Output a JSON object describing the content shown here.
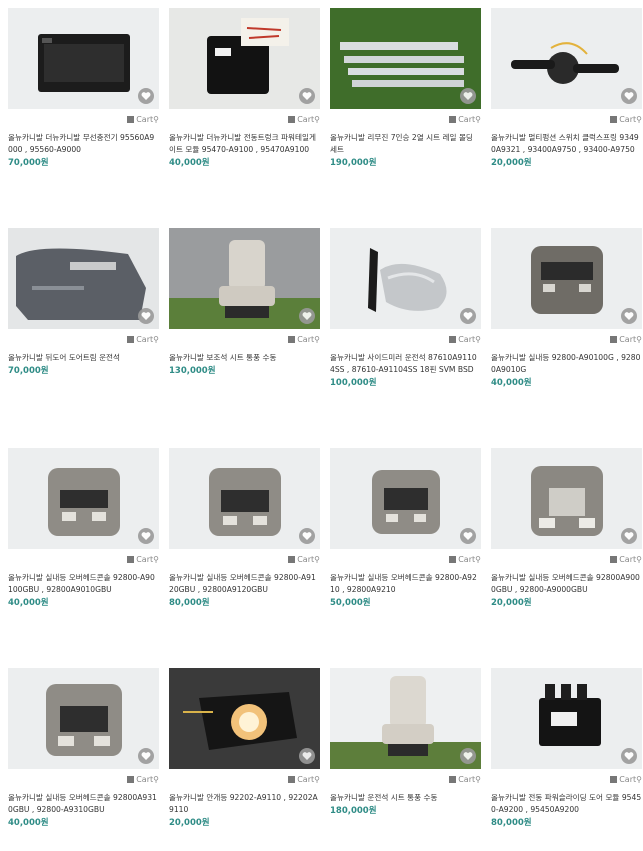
{
  "cart_label": "Cart",
  "heart_icon": "heart-icon",
  "products": [
    {
      "title": "올뉴카니발 더뉴카니발 무선충전기 95560A9000 , 95560-A9000",
      "price": "70,000원",
      "image": "wireless-charger-unit"
    },
    {
      "title": "올뉴카니발 더뉴카니발 전동트렁크 파워테일게이트 모듈 95470-A9100 , 95470A9100",
      "price": "40,000원",
      "image": "black-control-module"
    },
    {
      "title": "올뉴카니발 리무진 7인승 2열 시트 레일 몰딩 세트",
      "price": "190,000원",
      "image": "seat-rail-moldings"
    },
    {
      "title": "올뉴카니발 멀티펑션 스위치 클럭스프링 93490A9321 , 93400A9750 , 93400-A9750",
      "price": "20,000원",
      "image": "multifunction-switch"
    },
    {
      "title": "올뉴카니발 뒤도어 도어트림 운전석",
      "price": "70,000원",
      "image": "door-trim"
    },
    {
      "title": "올뉴카니발 보조석 시트 통풍 수동",
      "price": "130,000원",
      "image": "passenger-seat"
    },
    {
      "title": "올뉴카니발 사이드미러 운전석 87610A91104SS , 87610-A91104SS 18핀 SVM BSD",
      "price": "100,000원",
      "image": "side-mirror"
    },
    {
      "title": "올뉴카니발 실내등 92800-A90100G , 92800A9010G",
      "price": "40,000원",
      "image": "dome-light-a"
    },
    {
      "title": "올뉴카니발 실내등 오버헤드콘솔 92800-A90100GBU , 92800A9010GBU",
      "price": "40,000원",
      "image": "dome-light-b"
    },
    {
      "title": "올뉴카니발 실내등 오버헤드콘솔 92800-A9120GBU , 92800A9120GBU",
      "price": "80,000원",
      "image": "dome-light-c"
    },
    {
      "title": "올뉴카니발 실내등 오버헤드콘솔 92800-A9210 , 92800A9210",
      "price": "50,000원",
      "image": "dome-light-d"
    },
    {
      "title": "올뉴카니발 실내등 오버헤드콘솔 92800A9000GBU , 92800-A9000GBU",
      "price": "20,000원",
      "image": "dome-light-e"
    },
    {
      "title": "올뉴카니발 실내등 오버헤드콘솔 92800A9310GBU , 92800-A9310GBU",
      "price": "40,000원",
      "image": "dome-light-f"
    },
    {
      "title": "올뉴카니발 안개등 92202-A9110 , 92202A9110",
      "price": "20,000원",
      "image": "fog-lamp"
    },
    {
      "title": "올뉴카니발 운전석 시트 통풍 수동",
      "price": "180,000원",
      "image": "driver-seat"
    },
    {
      "title": "올뉴카니발 전동 파워슬라이딩 도어 모듈 95450-A9200 , 95450A9200",
      "price": "80,000원",
      "image": "sliding-door-module"
    }
  ]
}
